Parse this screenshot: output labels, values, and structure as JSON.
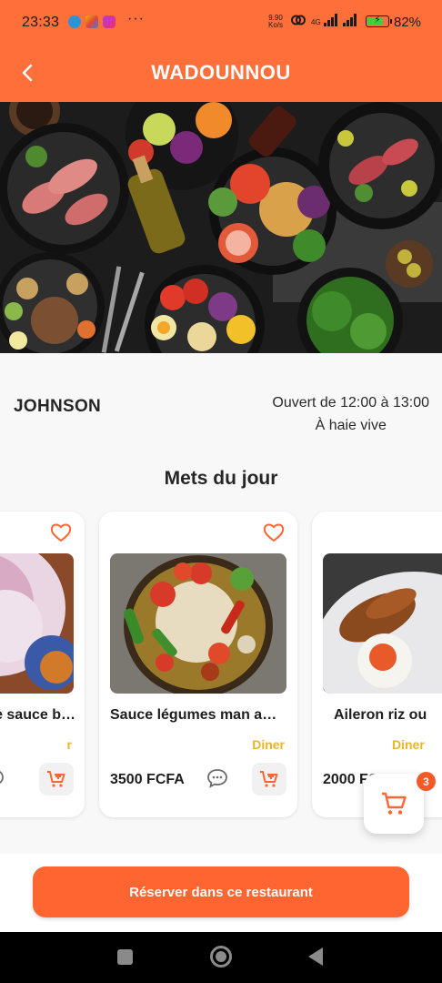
{
  "status_bar": {
    "time": "23:33",
    "dots": "···",
    "net_speed_value": "9.90",
    "net_speed_unit": "Ko/s",
    "network_tag": "4G",
    "battery_percent": "82",
    "battery_label": "82%",
    "icons": [
      "telegram-icon",
      "photos-icon",
      "instagram-icon",
      "hotspot-icon",
      "signal-icon",
      "battery-charging-icon"
    ]
  },
  "app_bar": {
    "title": "WADOUNNOU",
    "back_icon": "back-arrow-icon"
  },
  "restaurant": {
    "name": "JOHNSON",
    "hours": "Ouvert de 12:00 à 13:00",
    "address": "À haie vive"
  },
  "section_title": "Mets du jour",
  "dishes": [
    {
      "name": "e sauce b…",
      "category": "r",
      "price": "",
      "image": "coleslaw-salad"
    },
    {
      "name": "Sauce légumes man  a…",
      "category": "Diner",
      "price": "3500 FCFA",
      "image": "vegetable-sauce"
    },
    {
      "name": "Aileron riz ou",
      "category": "Diner",
      "price": "2000 FCFA",
      "image": "chicken-wings-rice"
    }
  ],
  "cart": {
    "count": "3"
  },
  "reserve_button": "Réserver dans ce restaurant",
  "colors": {
    "primary": "#ff6f3a",
    "button": "#ff6530",
    "category": "#e8b52a",
    "badge": "#f25a2a"
  }
}
